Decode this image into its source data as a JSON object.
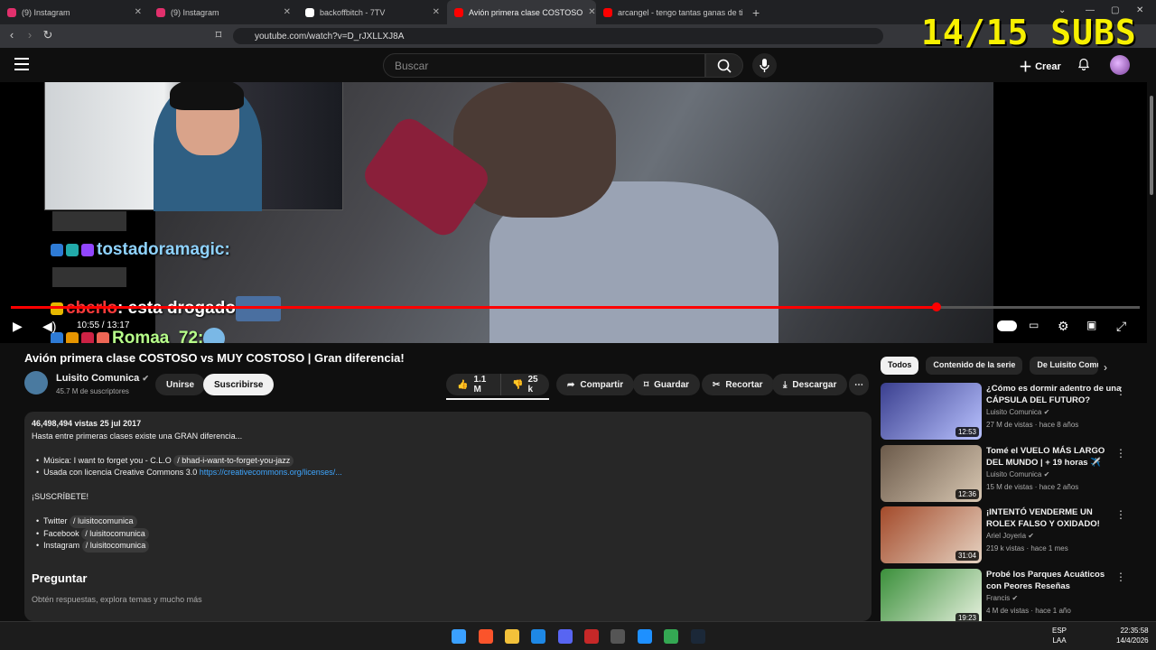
{
  "browser": {
    "tabs": [
      {
        "label": "(9) Instagram",
        "color": "#e1306c"
      },
      {
        "label": "(9) Instagram",
        "color": "#e1306c"
      },
      {
        "label": "backoffbitch - 7TV",
        "color": "#ffffff"
      },
      {
        "label": "Avión primera clase COSTOSO",
        "color": "#ff0000",
        "active": true
      },
      {
        "label": "arcangel - tengo tantas ganas de ti (",
        "color": "#ff0000"
      }
    ],
    "new_tab": "+",
    "url": "youtube.com/watch?v=D_rJXLLXJ8A"
  },
  "overlay": {
    "subs_counter": "14/15 SUBS",
    "chat": [
      {
        "user": "tostadoramagic:",
        "message": "",
        "color": "#8fd3ff"
      },
      {
        "user": "cberlo",
        "message": ": esta drogado",
        "color": "#ff3b3b"
      },
      {
        "user": "Romaa_72:",
        "message": "",
        "color": "#b7ff8a"
      }
    ]
  },
  "youtube": {
    "search_placeholder": "Buscar",
    "create_label": "Crear",
    "player": {
      "time": "10:55 / 13:17",
      "progress": 0.82
    },
    "video": {
      "title": "Avión primera clase COSTOSO vs MUY COSTOSO | Gran diferencia!",
      "channel": "Luisito Comunica",
      "subscribers": "45.7 M de suscriptores",
      "join_label": "Unirse",
      "subscribe_label": "Suscribirse",
      "likes": "1.1 M",
      "dislikes": "25 k",
      "share": "Compartir",
      "save": "Guardar",
      "clip": "Recortar",
      "download": "Descargar"
    },
    "description": {
      "stats": "46,498,494 vistas  25 jul 2017",
      "line1": "Hasta entre primeras clases existe una GRAN diferencia...",
      "music_prefix": "Música: I want to forget you - C.L.O",
      "music_chip": "/ bhad-i-want-to-forget-you-jazz",
      "license_prefix": "Usada con licencia Creative Commons 3.0",
      "license_link": "https://creativecommons.org/licenses/...",
      "subscribe_cta": "¡SUSCRÍBETE!",
      "socials": [
        {
          "name": "Twitter",
          "handle": "/ luisitocomunica"
        },
        {
          "name": "Facebook",
          "handle": "/ luisitocomunica"
        },
        {
          "name": "Instagram",
          "handle": "/ luisitocomunica"
        }
      ]
    },
    "ask": {
      "title": "Preguntar",
      "subtitle": "Obtén respuestas, explora temas y mucho más"
    },
    "chips": [
      "Todos",
      "Contenido de la serie",
      "De Luisito Comu"
    ],
    "recommendations": [
      {
        "title": "¿Cómo es dormir adentro de una CÁPSULA DEL FUTURO?",
        "channel": "Luisito Comunica",
        "meta": "27 M de vistas · hace 8 años",
        "duration": "12:53",
        "colors": [
          "#3a3f8f",
          "#b9c2ff"
        ]
      },
      {
        "title": "Tomé el VUELO MÁS LARGO DEL MUNDO | + 19 horas ✈️",
        "channel": "Luisito Comunica",
        "meta": "15 M de vistas · hace 2 años",
        "duration": "12:36",
        "colors": [
          "#6b5a4a",
          "#d8c7b2"
        ]
      },
      {
        "title": "¡INTENTÓ VENDERME UN ROLEX FALSO Y OXIDADO!",
        "channel": "Ariel Joyeria",
        "meta": "219 k vistas · hace 1 mes",
        "duration": "31:04",
        "colors": [
          "#a34a2a",
          "#e6d3c2"
        ]
      },
      {
        "title": "Probé los Parques Acuáticos con Peores Reseñas",
        "channel": "Francis",
        "meta": "4 M de vistas · hace 1 año",
        "duration": "19:23",
        "colors": [
          "#3a8f3a",
          "#e9f2e0"
        ]
      }
    ]
  },
  "taskbar": {
    "lang": "ESP",
    "lang2": "LAA",
    "time": "22:35:58",
    "date": "14/4/2026"
  }
}
